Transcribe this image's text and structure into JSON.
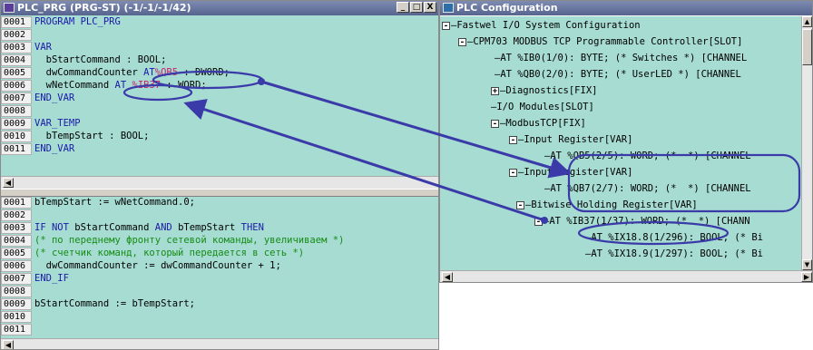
{
  "left_window": {
    "title": "PLC_PRG (PRG-ST) (-1/-1/-1/42)",
    "buttons": [
      "_",
      "□",
      "X"
    ],
    "declaration": {
      "lines": [
        {
          "num": "0001",
          "segments": [
            {
              "t": "PROGRAM PLC_PRG",
              "c": "kw"
            }
          ]
        },
        {
          "num": "0002",
          "segments": []
        },
        {
          "num": "0003",
          "segments": [
            {
              "t": "VAR",
              "c": "kw"
            }
          ]
        },
        {
          "num": "0004",
          "segments": [
            {
              "t": "  bStartCommand : BOOL;",
              "c": ""
            }
          ]
        },
        {
          "num": "0005",
          "segments": [
            {
              "t": "  dwCommandCounter ",
              "c": ""
            },
            {
              "t": "AT",
              "c": "kw"
            },
            {
              "t": "%QB5",
              "c": "addr"
            },
            {
              "t": " : DWORD;",
              "c": ""
            }
          ]
        },
        {
          "num": "0006",
          "segments": [
            {
              "t": "  wNetCommand ",
              "c": ""
            },
            {
              "t": "AT",
              "c": "kw"
            },
            {
              "t": " %IB37",
              "c": "addr"
            },
            {
              "t": " : WORD;",
              "c": ""
            }
          ]
        },
        {
          "num": "0007",
          "segments": [
            {
              "t": "END_VAR",
              "c": "kw"
            }
          ]
        },
        {
          "num": "0008",
          "segments": []
        },
        {
          "num": "0009",
          "segments": [
            {
              "t": "VAR_TEMP",
              "c": "kw"
            }
          ]
        },
        {
          "num": "0010",
          "segments": [
            {
              "t": "  bTempStart : BOOL;",
              "c": ""
            }
          ]
        },
        {
          "num": "0011",
          "segments": [
            {
              "t": "END_VAR",
              "c": "kw"
            }
          ]
        }
      ]
    },
    "body": {
      "lines": [
        {
          "num": "0001",
          "segments": [
            {
              "t": "bTempStart := wNetCommand.0;",
              "c": ""
            }
          ]
        },
        {
          "num": "0002",
          "segments": []
        },
        {
          "num": "0003",
          "segments": [
            {
              "t": "IF NOT ",
              "c": "kw"
            },
            {
              "t": "bStartCommand ",
              "c": ""
            },
            {
              "t": "AND ",
              "c": "kw"
            },
            {
              "t": "bTempStart ",
              "c": ""
            },
            {
              "t": "THEN",
              "c": "kw"
            }
          ]
        },
        {
          "num": "0004",
          "segments": [
            {
              "t": "(* по переднему фронту сетевой команды, увеличиваем *)",
              "c": "comment"
            }
          ]
        },
        {
          "num": "0005",
          "segments": [
            {
              "t": "(* счетчик команд, который передается в сеть *)",
              "c": "comment"
            }
          ]
        },
        {
          "num": "0006",
          "segments": [
            {
              "t": "  dwCommandCounter := dwCommandCounter + 1;",
              "c": ""
            }
          ]
        },
        {
          "num": "0007",
          "segments": [
            {
              "t": "END_IF",
              "c": "kw"
            }
          ]
        },
        {
          "num": "0008",
          "segments": []
        },
        {
          "num": "0009",
          "segments": [
            {
              "t": "bStartCommand := bTempStart;",
              "c": ""
            }
          ]
        },
        {
          "num": "0010",
          "segments": []
        },
        {
          "num": "0011",
          "segments": []
        }
      ]
    }
  },
  "right_window": {
    "title": "PLC Configuration",
    "tree": [
      {
        "toggle": "-",
        "text": "Fastwel I/O System Configuration"
      },
      {
        "toggle": "-",
        "text": "CPM703 MODBUS TCP Programmable Controller[SLOT]"
      },
      {
        "toggle": "",
        "text": "AT %IB0(1/0): BYTE; (* Switches *) [CHANNEL"
      },
      {
        "toggle": "",
        "text": "AT %QB0(2/0): BYTE; (* UserLED *) [CHANNEL"
      },
      {
        "toggle": "+",
        "text": "Diagnostics[FIX]"
      },
      {
        "toggle": "",
        "text": "I/O Modules[SLOT]"
      },
      {
        "toggle": "-",
        "text": "ModbusTCP[FIX]"
      },
      {
        "toggle": "-",
        "text": "Input Register[VAR]"
      },
      {
        "toggle": "",
        "text": "AT %QB5(2/5): WORD; (*  *) [CHANNEL"
      },
      {
        "toggle": "-",
        "text": "Input Register[VAR]"
      },
      {
        "toggle": "",
        "text": "AT %QB7(2/7): WORD; (*  *) [CHANNEL"
      },
      {
        "toggle": "-",
        "text": "Bitwise Holding Register[VAR]"
      },
      {
        "toggle": "-",
        "text": "AT %IB37(1/37): WORD; (*  *) [CHANN"
      },
      {
        "toggle": "",
        "text": "AT %IX18.8(1/296): BOOL; (* Bi"
      },
      {
        "toggle": "",
        "text": "AT %IX18.9(1/297): BOOL; (* Bi"
      }
    ]
  },
  "colors": {
    "editor_bg": "#a7dcd3",
    "keyword": "#1a1aa8",
    "address": "#c81e6c",
    "comment": "#148c14",
    "annotation": "#3a3aa8"
  }
}
